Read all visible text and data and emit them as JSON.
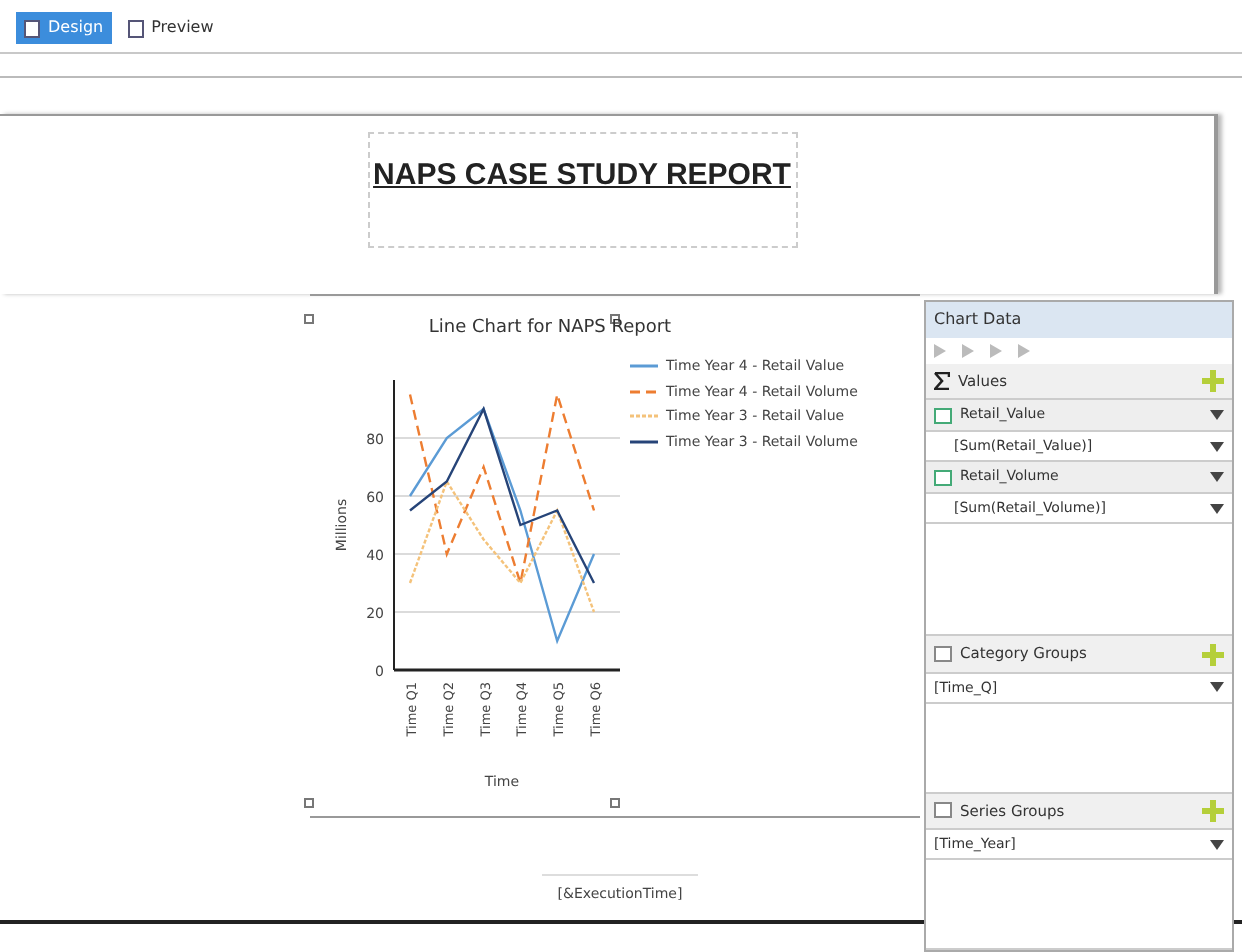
{
  "tabs": [
    {
      "label": "Design",
      "selected": true
    },
    {
      "label": "Preview",
      "selected": false
    }
  ],
  "report": {
    "title": "NAPS CASE STUDY REPORT",
    "footer": "[&ExecutionTime]",
    "chart": {
      "chart_data": {
        "type": "line",
        "title": "Line Chart for NAPS Report",
        "xlabel": "Time",
        "ylabel": "Millions",
        "categories": [
          "Time Q1",
          "Time Q2",
          "Time Q3",
          "Time Q4",
          "Time Q5",
          "Time Q6"
        ],
        "ylim": [
          0,
          100
        ],
        "yticks": [
          0,
          20,
          40,
          60,
          80
        ],
        "grid": true,
        "legend": true,
        "series": [
          {
            "name": "Time Year 4 - Retail Value",
            "color": "#5b9bd5",
            "line_style": "solid",
            "values": [
              60,
              80,
              90,
              55,
              10,
              40
            ]
          },
          {
            "name": "Time Year 4 - Retail Volume",
            "color": "#ed7d31",
            "line_style": "dashed",
            "values": [
              95,
              40,
              70,
              30,
              95,
              55
            ]
          },
          {
            "name": "Time Year 3 - Retail Value",
            "color": "#f4c27a",
            "line_style": "dotted",
            "values": [
              30,
              65,
              45,
              30,
              55,
              20
            ]
          },
          {
            "name": "Time Year 3 - Retail Volume",
            "color": "#264478",
            "line_style": "solid",
            "values": [
              55,
              65,
              90,
              50,
              55,
              30
            ]
          }
        ]
      }
    }
  },
  "chart_data_panel": {
    "title": "Chart Data",
    "sections": [
      {
        "kind": "values",
        "label": "Values",
        "items": [
          {
            "kind": "field",
            "label": "Retail_Value"
          },
          {
            "kind": "expression",
            "label": "[Sum(Retail_Value)]"
          },
          {
            "kind": "field",
            "label": "Retail_Volume"
          },
          {
            "kind": "expression",
            "label": "[Sum(Retail_Volume)]"
          }
        ]
      },
      {
        "kind": "groups",
        "label": "Category Groups",
        "items": [
          {
            "kind": "group",
            "label": "[Time_Q]"
          }
        ]
      },
      {
        "kind": "groups",
        "label": "Series Groups",
        "items": [
          {
            "kind": "group",
            "label": "[Time_Year]"
          }
        ]
      }
    ]
  }
}
